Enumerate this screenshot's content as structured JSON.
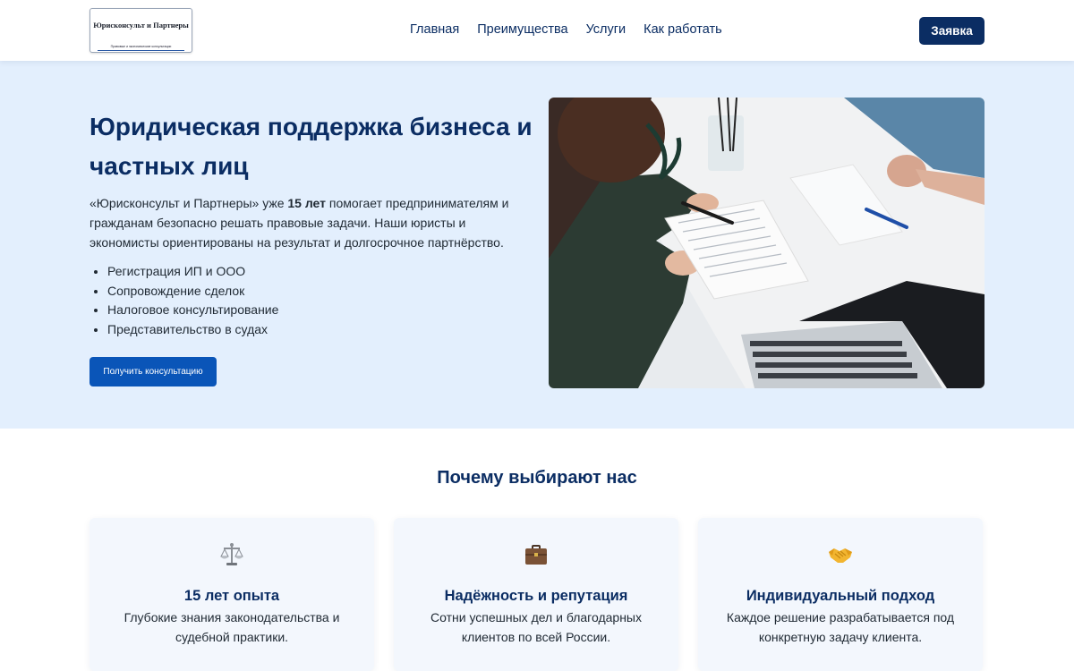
{
  "header": {
    "logo": {
      "title": "Юрисконсульт и Партнеры",
      "subtitle": "Правовые и экономические консультации"
    },
    "nav": [
      "Главная",
      "Преимущества",
      "Услуги",
      "Как работать"
    ],
    "cta_label": "Заявка"
  },
  "hero": {
    "title": "Юридическая поддержка бизнеса и частных лиц",
    "intro_prefix": "«Юрисконсульт и Партнеры» уже ",
    "intro_bold": "15 лет",
    "intro_suffix": " помогает предпринимателям и гражданам безопасно решать правовые задачи. Наши юристы и экономисты ориентированы на результат и долгосрочное партнёрство.",
    "services": [
      "Регистрация ИП и ООО",
      "Сопровождение сделок",
      "Налоговое консультирование",
      "Представительство в судах"
    ],
    "button_label": "Получить консультацию"
  },
  "features": {
    "title": "Почему выбирают нас",
    "cards": [
      {
        "icon": "scales-icon",
        "title": "15 лет опыта",
        "text": "Глубокие знания законодательства и судебной практики."
      },
      {
        "icon": "briefcase-icon",
        "title": "Надёжность и репутация",
        "text": "Сотни успешных дел и благодарных клиентов по всей России."
      },
      {
        "icon": "handshake-icon",
        "title": "Индивидуальный подход",
        "text": "Каждое решение разрабатывается под конкретную задачу клиента."
      }
    ]
  },
  "colors": {
    "brand_dark": "#0b2d63",
    "brand_button": "#0a55b8",
    "hero_background": "#e3effd",
    "card_background": "#f3f7fd"
  }
}
